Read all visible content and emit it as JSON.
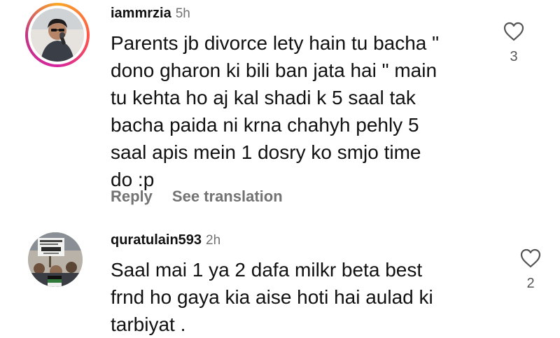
{
  "comments": [
    {
      "username": "iammrzia",
      "time": "5h",
      "lines": [
        "Parents jb divorce lety hain tu bacha \"",
        "dono gharon ki bili ban jata hai \" main",
        "tu kehta ho aj kal shadi k 5 saal tak",
        "bacha paida ni krna chahyh pehly 5",
        "saal apis mein 1 dosry ko smjo time",
        "do :p"
      ],
      "reply_label": "Reply",
      "translate_label": "See translation",
      "like_count": "3"
    },
    {
      "username": "quratulain593",
      "time": "2h",
      "lines": [
        "Saal mai 1 ya 2 dafa milkr beta best",
        "frnd ho gaya kia aise hoti hai aulad ki",
        "tarbiyat ."
      ],
      "like_count": "2"
    }
  ],
  "colors": {
    "primary_text": "#111111",
    "secondary_text": "#737373",
    "story_ring_start": "#f9a825",
    "story_ring_end": "#c13584"
  },
  "icons": {
    "like": "heart-outline-icon"
  }
}
